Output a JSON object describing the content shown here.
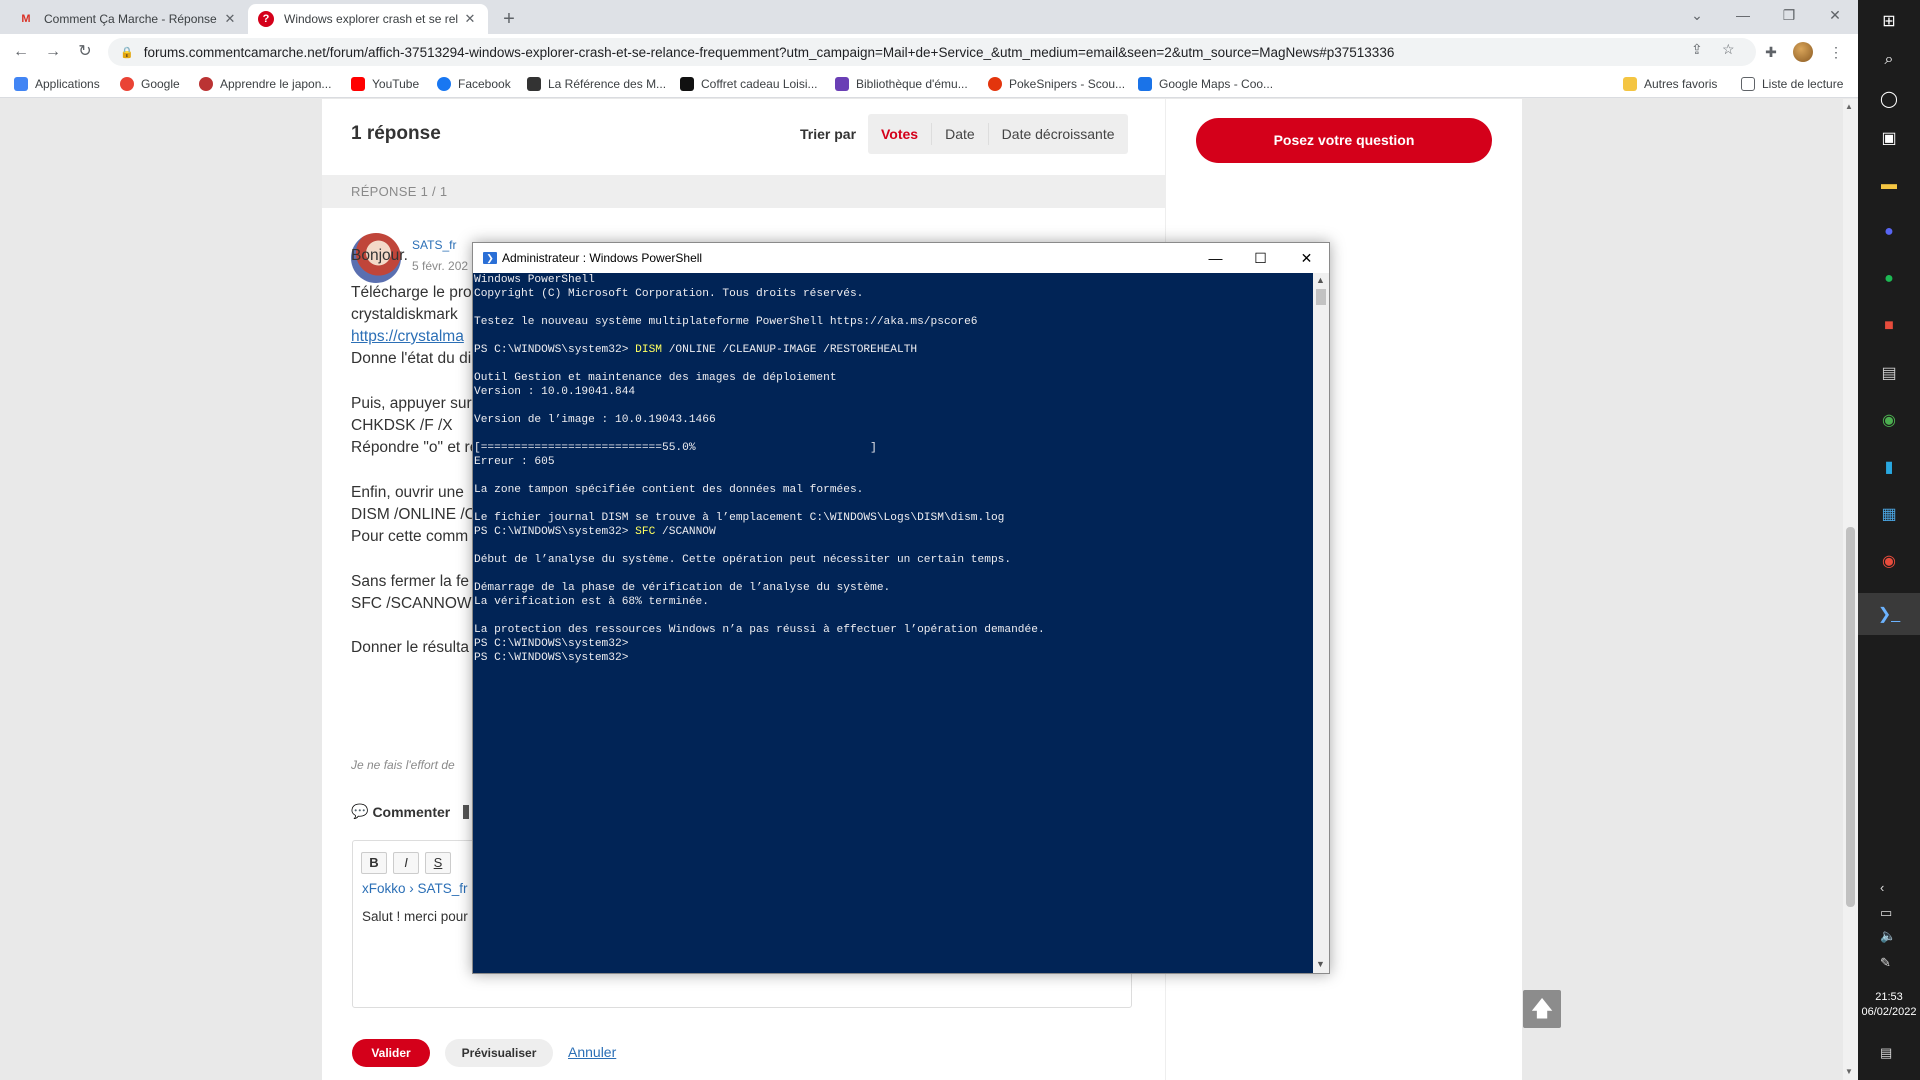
{
  "browser": {
    "tabs": [
      {
        "title": "Comment Ça Marche - Réponse",
        "favicon": "gmail-icon",
        "active": false
      },
      {
        "title": "Windows explorer crash et se rel",
        "favicon": "ccm-icon",
        "active": true
      }
    ],
    "url": "forums.commentcamarche.net/forum/affich-37513294-windows-explorer-crash-et-se-relance-frequemment?utm_campaign=Mail+de+Service_&utm_medium=email&seen=2&utm_source=MagNews#p37513336",
    "bookmarks": [
      {
        "label": "Applications",
        "color": "#4285f4"
      },
      {
        "label": "Google",
        "color": "#ea4335"
      },
      {
        "label": "Apprendre le japon...",
        "color": "#b33"
      },
      {
        "label": "YouTube",
        "color": "#ff0000"
      },
      {
        "label": "Facebook",
        "color": "#1877f2"
      },
      {
        "label": "La Référence des M...",
        "color": "#333333"
      },
      {
        "label": "Coffret cadeau Loisi...",
        "color": "#111111"
      },
      {
        "label": "Bibliothèque d'ému...",
        "color": "#6a3fb5"
      },
      {
        "label": "PokeSnipers - Scou...",
        "color": "#e3350d"
      },
      {
        "label": "Google Maps - Coo...",
        "color": "#1a73e8"
      }
    ],
    "other_bookmarks": "Autres favoris",
    "reading_list": "Liste de lecture"
  },
  "page": {
    "responses_title": "1 réponse",
    "sort_label": "Trier par",
    "sort_options": [
      "Votes",
      "Date",
      "Date décroissante"
    ],
    "response_counter": "RÉPONSE 1 / 1",
    "author": "SATS_fr",
    "date": "5 févr. 202",
    "text_lines": [
      "Bonjour.",
      "Télécharge le pro",
      "crystaldiskmark",
      "https://crystalma",
      "Donne l'état du di",
      "Puis, appuyer sur",
      "CHKDSK /F /X",
      "Répondre \"o\" et re",
      "Enfin, ouvrir une",
      "DISM /ONLINE /C",
      "Pour cette comm",
      "Sans fermer la fe",
      "SFC /SCANNOW",
      "Donner le résulta"
    ],
    "signature": "Je ne fais l'effort de",
    "comment_label": "Commenter",
    "editor": {
      "bold": "B",
      "italic": "I",
      "strike": "S",
      "crumb": "xFokko › SATS_fr",
      "text": "Salut ! merci pour"
    },
    "valider": "Valider",
    "preview": "Prévisualiser",
    "cancel": "Annuler",
    "ask_button": "Posez votre question",
    "accent_color": "#d4001a"
  },
  "powershell": {
    "title": "Administrateur : Windows PowerShell",
    "lines": [
      {
        "t": "Windows PowerShell"
      },
      {
        "t": "Copyright (C) Microsoft Corporation. Tous droits réservés."
      },
      {
        "t": ""
      },
      {
        "t": "Testez le nouveau système multiplateforme PowerShell https://aka.ms/pscore6"
      },
      {
        "t": ""
      },
      {
        "p": "PS C:\\WINDOWS\\system32> ",
        "c": "DISM",
        "t": " /ONLINE /CLEANUP-IMAGE /RESTOREHEALTH"
      },
      {
        "t": ""
      },
      {
        "t": "Outil Gestion et maintenance des images de déploiement"
      },
      {
        "t": "Version : 10.0.19041.844"
      },
      {
        "t": ""
      },
      {
        "t": "Version de l’image : 10.0.19043.1466"
      },
      {
        "t": ""
      },
      {
        "t": "[===========================55.0%                          ]"
      },
      {
        "t": "Erreur : 605"
      },
      {
        "t": ""
      },
      {
        "t": "La zone tampon spécifiée contient des données mal formées."
      },
      {
        "t": ""
      },
      {
        "t": "Le fichier journal DISM se trouve à l’emplacement C:\\WINDOWS\\Logs\\DISM\\dism.log"
      },
      {
        "p": "PS C:\\WINDOWS\\system32> ",
        "c": "SFC",
        "t": " /SCANNOW"
      },
      {
        "t": ""
      },
      {
        "t": "Début de l’analyse du système. Cette opération peut nécessiter un certain temps."
      },
      {
        "t": ""
      },
      {
        "t": "Démarrage de la phase de vérification de l’analyse du système."
      },
      {
        "t": "La vérification est à 68% terminée."
      },
      {
        "t": ""
      },
      {
        "t": "La protection des ressources Windows n’a pas réussi à effectuer l’opération demandée."
      },
      {
        "t": "PS C:\\WINDOWS\\system32>"
      },
      {
        "t": "PS C:\\WINDOWS\\system32>"
      }
    ],
    "bg_color": "#012456",
    "cmd_color": "#ffff60"
  },
  "taskbar": {
    "time": "21:53",
    "date": "06/02/2022"
  }
}
